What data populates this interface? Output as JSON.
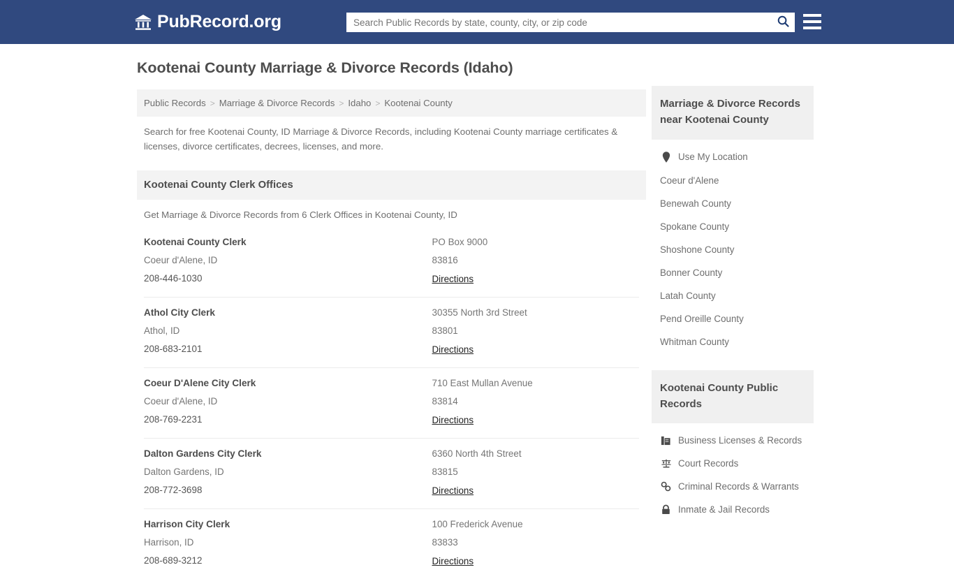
{
  "header": {
    "brand_name": "PubRecord.org",
    "brand_icon": "bank-building-icon",
    "search": {
      "placeholder": "Search Public Records by state, county, city, or zip code",
      "value": "",
      "icon": "search-icon"
    },
    "menu_icon": "hamburger-menu-icon",
    "bg_color": "#30497f"
  },
  "main": {
    "page_title": "Kootenai County Marriage & Divorce Records (Idaho)",
    "breadcrumb": [
      "Public Records",
      "Marriage & Divorce Records",
      "Idaho",
      "Kootenai County"
    ],
    "breadcrumb_separator": ">",
    "intro": "Search for free Kootenai County, ID Marriage & Divorce Records, including Kootenai County marriage certificates & licenses, divorce certificates, decrees, licenses, and more.",
    "section_title": "Kootenai County Clerk Offices",
    "section_subtitle": "Get Marriage & Divorce Records from 6 Clerk Offices in Kootenai County, ID",
    "directions_label": "Directions",
    "offices": [
      {
        "name": "Kootenai County Clerk",
        "city_state": "Coeur d'Alene, ID",
        "phone": "208-446-1030",
        "address": "PO Box 9000",
        "zip": "83816"
      },
      {
        "name": "Athol City Clerk",
        "city_state": "Athol, ID",
        "phone": "208-683-2101",
        "address": "30355 North 3rd Street",
        "zip": "83801"
      },
      {
        "name": "Coeur D'Alene City Clerk",
        "city_state": "Coeur d'Alene, ID",
        "phone": "208-769-2231",
        "address": "710 East Mullan Avenue",
        "zip": "83814"
      },
      {
        "name": "Dalton Gardens City Clerk",
        "city_state": "Dalton Gardens, ID",
        "phone": "208-772-3698",
        "address": "6360 North 4th Street",
        "zip": "83815"
      },
      {
        "name": "Harrison City Clerk",
        "city_state": "Harrison, ID",
        "phone": "208-689-3212",
        "address": "100 Frederick Avenue",
        "zip": "83833"
      }
    ]
  },
  "sidebar": {
    "nearby": {
      "title": "Marriage & Divorce Records near Kootenai County",
      "items": [
        {
          "label": "Use My Location",
          "icon": "map-pin-icon"
        },
        {
          "label": "Coeur d'Alene",
          "icon": ""
        },
        {
          "label": "Benewah County",
          "icon": ""
        },
        {
          "label": "Spokane County",
          "icon": ""
        },
        {
          "label": "Shoshone County",
          "icon": ""
        },
        {
          "label": "Bonner County",
          "icon": ""
        },
        {
          "label": "Latah County",
          "icon": ""
        },
        {
          "label": "Pend Oreille County",
          "icon": ""
        },
        {
          "label": "Whitman County",
          "icon": ""
        }
      ]
    },
    "public_records": {
      "title": "Kootenai County Public Records",
      "items": [
        {
          "label": "Business Licenses & Records",
          "icon": "office-building-icon"
        },
        {
          "label": "Court Records",
          "icon": "scales-of-justice-icon"
        },
        {
          "label": "Criminal Records & Warrants",
          "icon": "handcuffs-icon"
        },
        {
          "label": "Inmate & Jail Records",
          "icon": "lock-icon"
        }
      ]
    }
  }
}
